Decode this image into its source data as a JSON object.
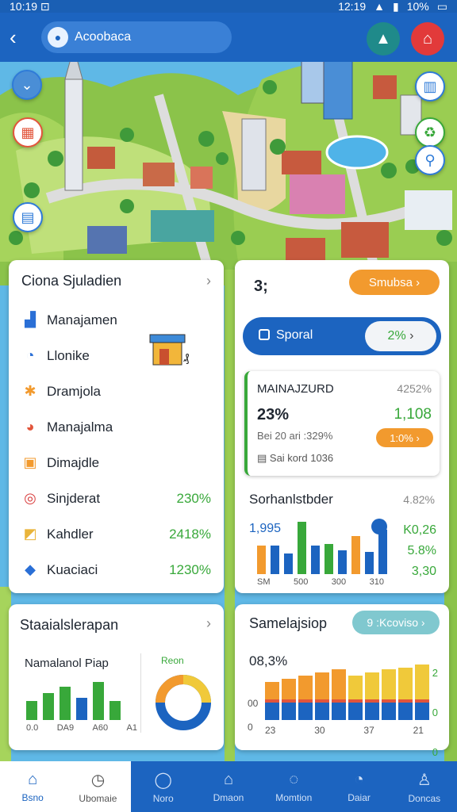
{
  "status": {
    "time": "10:19 ⊡",
    "time2": "12:19",
    "battery": "10%"
  },
  "header": {
    "search_text": "Acoobaca"
  },
  "card_list": {
    "title": "Ciona Sjuladien",
    "items": [
      {
        "label": "Manajamen",
        "value": "",
        "icon": "▟",
        "color": "#2a6fd6"
      },
      {
        "label": "Llonike",
        "value": "",
        "icon": "◔",
        "color": "#2a6fd6"
      },
      {
        "label": "Dramjola",
        "value": "",
        "icon": "✱",
        "color": "#f29a2e"
      },
      {
        "label": "Manajalma",
        "value": "",
        "icon": "◕",
        "color": "#e2553b"
      },
      {
        "label": "Dimajdle",
        "value": "",
        "icon": "▣",
        "color": "#f29a2e"
      },
      {
        "label": "Sinjderat",
        "value": "230%",
        "icon": "◎",
        "color": "#d94040"
      },
      {
        "label": "Kahdler",
        "value": "2418%",
        "icon": "◩",
        "color": "#e9b43a"
      },
      {
        "label": "Kuaciaci",
        "value": "1230%",
        "icon": "◆",
        "color": "#2a6fd6"
      }
    ]
  },
  "card_stats": {
    "title": "3;",
    "pill": "Smubsa",
    "blue_pill_label": "Sporal",
    "blue_pill_value": "2%",
    "inner_title": "MAINAJZURD",
    "inner_pct": "4252%",
    "inner_big": "23%",
    "inner_value": "1,108",
    "inner_sub": "Bei 20 ari :329%",
    "inner_orange": "1:0%",
    "inner_note": "Sai kord 1036",
    "chart_title": "Sorhanlstbder",
    "chart_pct": "4.82%",
    "chart_left": "1,995",
    "right_vals": [
      "K0,26",
      "5.8%",
      "3,30"
    ],
    "xlabels": [
      "SM",
      "500",
      "300",
      "310"
    ]
  },
  "card_bottom_left": {
    "title": "Staaialslerapan",
    "subtitle": "Namalanol Piap",
    "donut_label": "Reon",
    "xlabels": [
      "0.0",
      "DA9",
      "A60",
      "A1"
    ]
  },
  "card_bottom_right": {
    "title": "Samelajsiop",
    "pill": "9 :Kcoviso",
    "big": "08,3%",
    "left_ticks": [
      "00",
      "0"
    ],
    "right_ticks": [
      "2",
      "0",
      "0"
    ],
    "xlabels": [
      "23",
      "30",
      "37",
      "21"
    ]
  },
  "nav": [
    {
      "label": "Bsno",
      "icon": "⌂",
      "active": true
    },
    {
      "label": "Ubomaie",
      "icon": "◷",
      "active": false
    },
    {
      "label": "Noro",
      "icon": "◯",
      "active": false
    },
    {
      "label": "Dmaon",
      "icon": "⌂",
      "active": false
    },
    {
      "label": "Momtion",
      "icon": "◌",
      "active": false
    },
    {
      "label": "Daiar",
      "icon": "◔",
      "active": false
    },
    {
      "label": "Doncas",
      "icon": "♙",
      "active": false
    }
  ],
  "colors": {
    "blue": "#1c64c0",
    "orange": "#f29a2e",
    "green": "#38a83a",
    "red": "#e2553b",
    "yellow": "#f0c93a"
  }
}
